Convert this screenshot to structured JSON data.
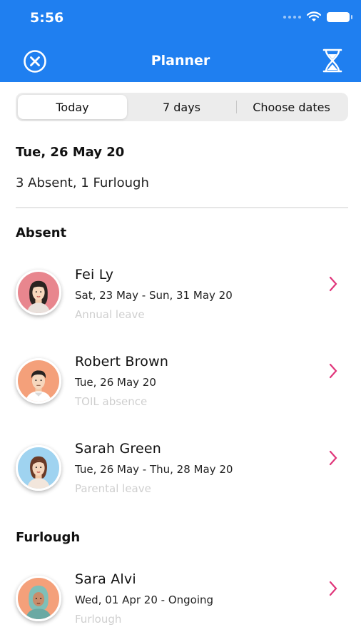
{
  "status_bar": {
    "time": "5:56"
  },
  "nav": {
    "title": "Planner",
    "left_icon": "close-circle-icon",
    "right_icon": "hourglass-icon"
  },
  "tabs": [
    {
      "label": "Today",
      "active": true
    },
    {
      "label": "7 days",
      "active": false
    },
    {
      "label": "Choose dates",
      "active": false
    }
  ],
  "date_heading": "Tue, 26 May 20",
  "summary": "3 Absent, 1 Furlough",
  "sections": {
    "absent": {
      "title": "Absent",
      "people": [
        {
          "name": "Fei Ly",
          "dates": "Sat, 23 May - Sun, 31 May 20",
          "type": "Annual leave",
          "avatar_bg": "#e8868e"
        },
        {
          "name": "Robert  Brown",
          "dates": "Tue, 26 May 20",
          "type": "TOIL absence",
          "avatar_bg": "#f4a07a"
        },
        {
          "name": "Sarah Green",
          "dates": "Tue, 26 May - Thu, 28 May 20",
          "type": "Parental leave",
          "avatar_bg": "#9fd3f0"
        }
      ]
    },
    "furlough": {
      "title": "Furlough",
      "people": [
        {
          "name": "Sara Alvi",
          "dates": "Wed, 01 Apr 20 - Ongoing",
          "type": "Furlough",
          "avatar_bg": "#f4a07a"
        }
      ]
    }
  },
  "colors": {
    "header": "#1f7ff0",
    "chevron": "#e0357a",
    "muted_text": "#cfcfcf"
  }
}
